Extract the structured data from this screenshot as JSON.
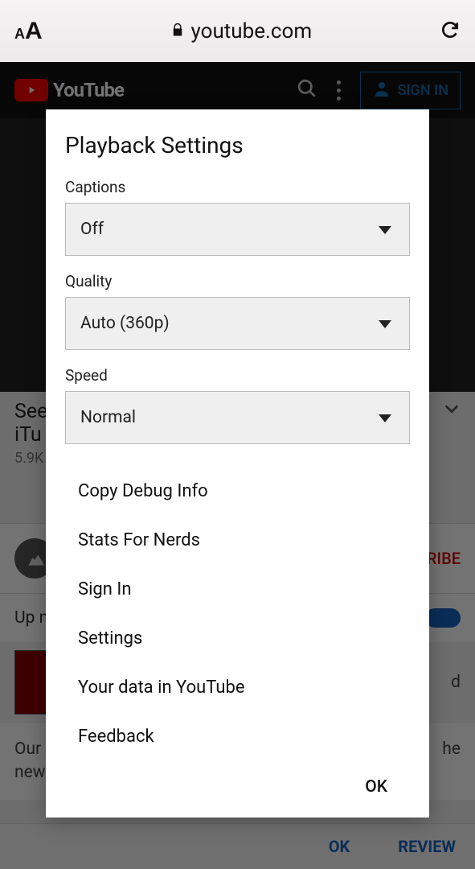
{
  "browser": {
    "url_domain": "youtube.com"
  },
  "yt": {
    "brand": "YouTube",
    "signin": "SIGN IN",
    "video_title_line1": "See",
    "video_title_line2": "iTu",
    "views": "5.9K",
    "subscribe": "RIBE",
    "upnext": "Up n",
    "desc_line1": "Our",
    "desc_line2": "new",
    "desc_right": "he",
    "list_item_d": "d",
    "cookie_ok": "OK",
    "cookie_review": "REVIEW"
  },
  "modal": {
    "title": "Playback Settings",
    "fields": {
      "captions": {
        "label": "Captions",
        "value": "Off"
      },
      "quality": {
        "label": "Quality",
        "value": "Auto (360p)"
      },
      "speed": {
        "label": "Speed",
        "value": "Normal"
      }
    },
    "menu": {
      "copy_debug": "Copy Debug Info",
      "stats": "Stats For Nerds",
      "sign_in": "Sign In",
      "settings": "Settings",
      "your_data": "Your data in YouTube",
      "feedback": "Feedback"
    },
    "ok": "OK"
  }
}
